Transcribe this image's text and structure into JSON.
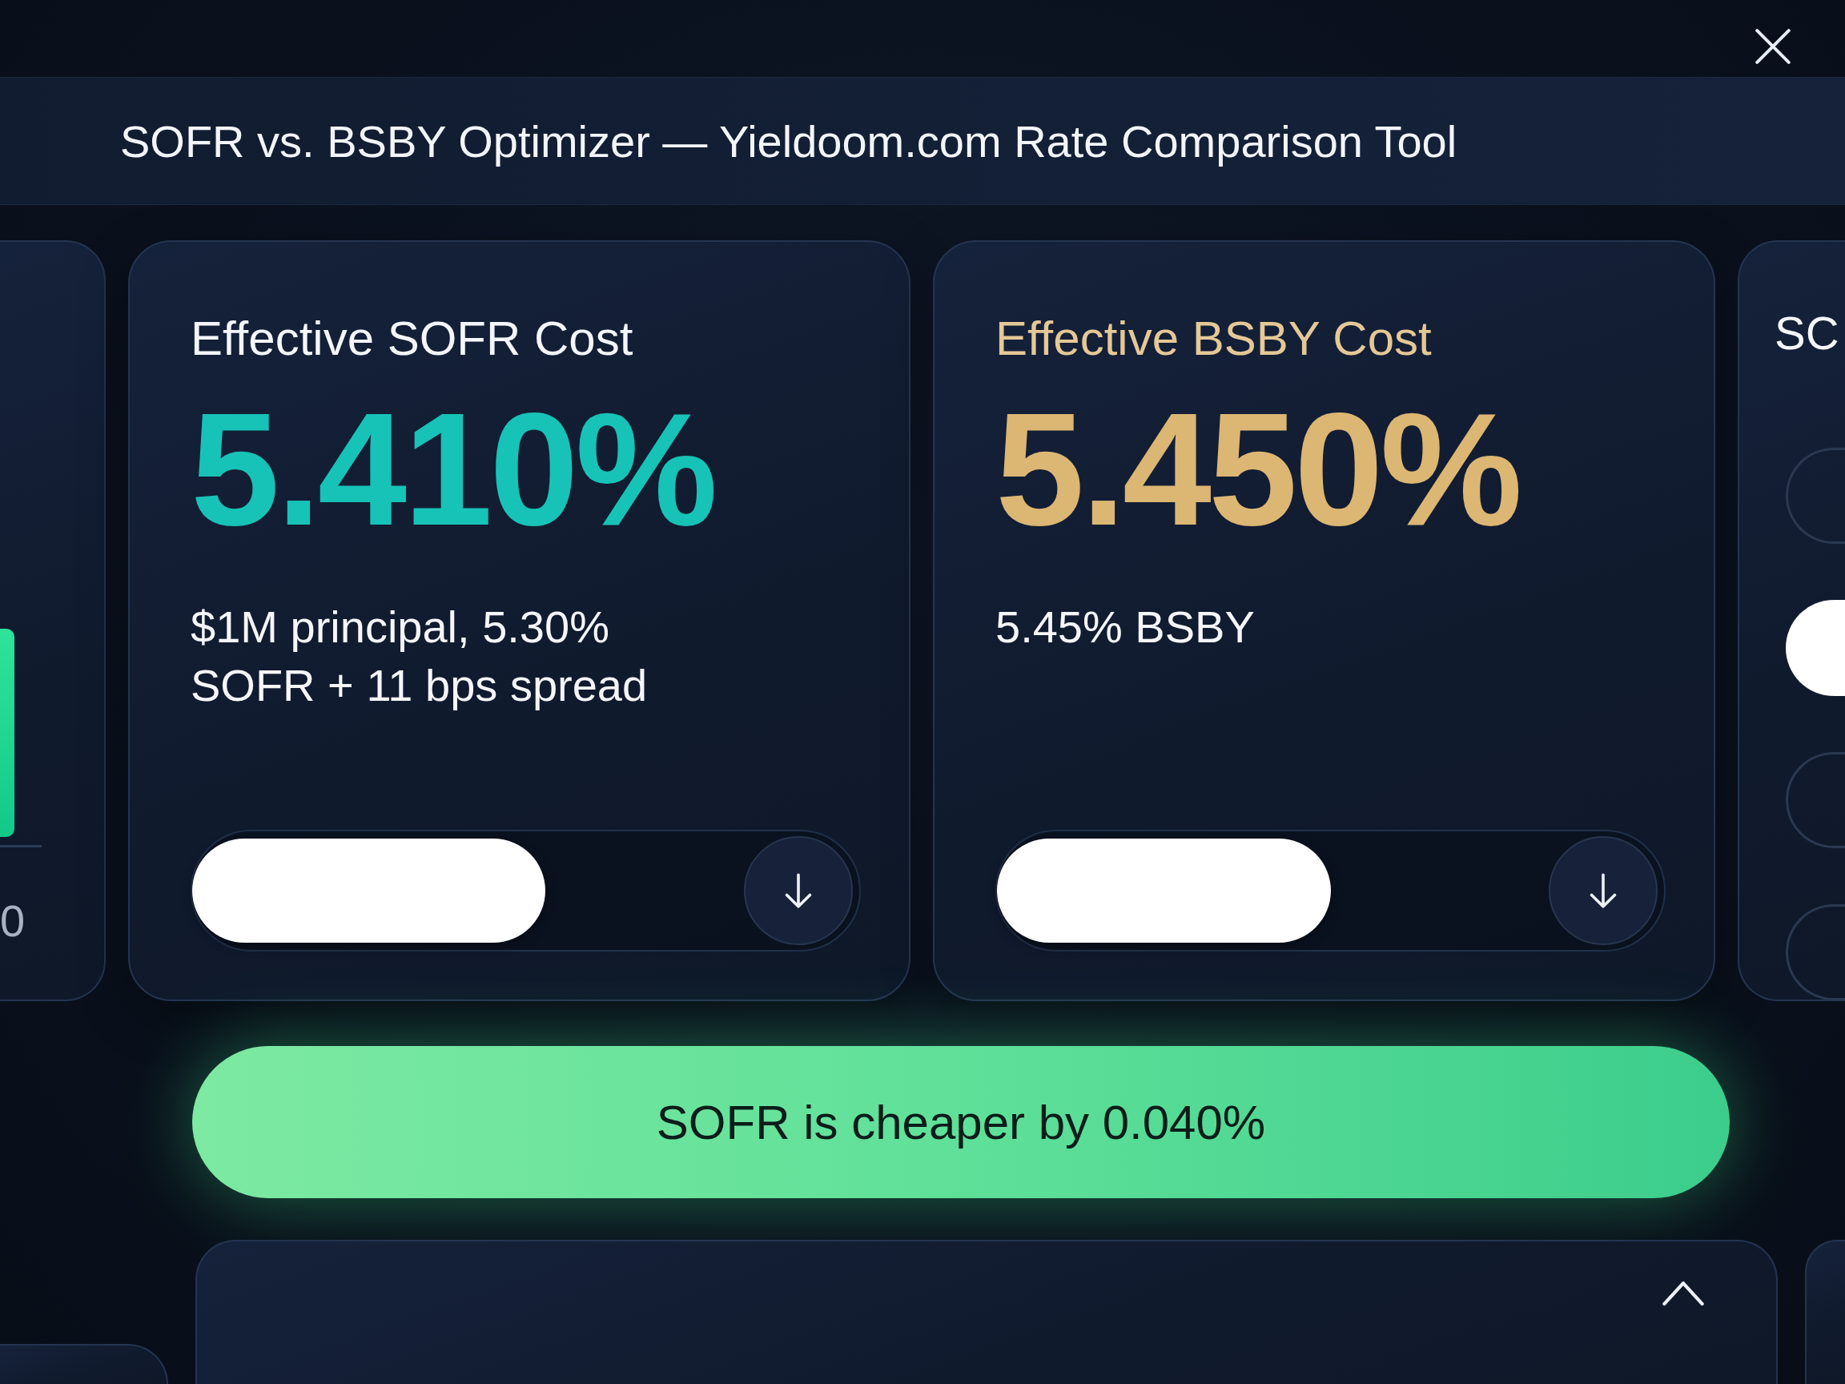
{
  "window": {
    "title": "SOFR vs. BSBY Optimizer — Yieldoom.com Rate Comparison Tool"
  },
  "side_panel_left": {
    "label": "0"
  },
  "cards": [
    {
      "kind": "plain",
      "color": "#17c3b7",
      "title": "Effective SOFR Cost",
      "value": "5.410%",
      "description": "$1M principal, 5.30% SOFR + 11 bps spread",
      "slider": {
        "level": 0.53
      }
    },
    {
      "kind": "accented",
      "color": "#dcb673",
      "title": "Effective BSBY Cost",
      "value": "5.450%",
      "description": "5.45% BSBY",
      "slider": {
        "level": 0.5
      }
    }
  ],
  "side_panel_right": {
    "title": "SC",
    "options": [
      {
        "selected": false
      },
      {
        "selected": true
      },
      {
        "selected": false
      },
      {
        "selected": false
      }
    ]
  },
  "result_banner": {
    "text": "SOFR is cheaper by 0.040%"
  }
}
